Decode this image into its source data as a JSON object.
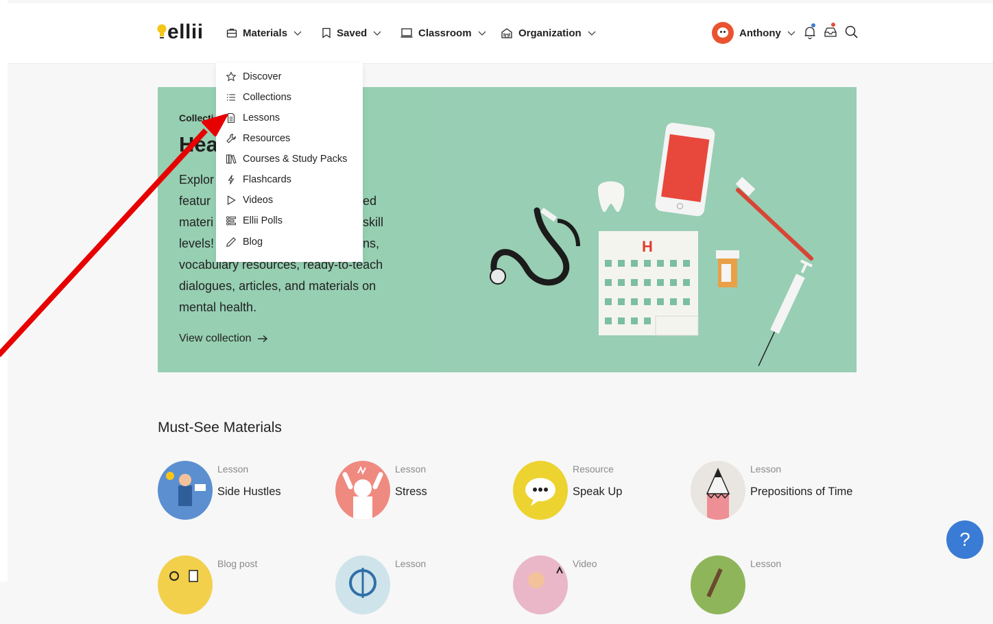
{
  "brand": {
    "logo_text": "ellii"
  },
  "nav": {
    "materials": "Materials",
    "saved": "Saved",
    "classroom": "Classroom",
    "organization": "Organization"
  },
  "user": {
    "name": "Anthony"
  },
  "dropdown": {
    "items": [
      {
        "label": "Discover",
        "icon": "star-icon"
      },
      {
        "label": "Collections",
        "icon": "list-icon"
      },
      {
        "label": "Lessons",
        "icon": "document-icon"
      },
      {
        "label": "Resources",
        "icon": "wrench-icon"
      },
      {
        "label": "Courses & Study Packs",
        "icon": "books-icon"
      },
      {
        "label": "Flashcards",
        "icon": "bolt-icon"
      },
      {
        "label": "Videos",
        "icon": "play-icon"
      },
      {
        "label": "Ellii Polls",
        "icon": "poll-icon"
      },
      {
        "label": "Blog",
        "icon": "pencil-icon"
      }
    ]
  },
  "hero": {
    "kicker": "Collecti",
    "title": "Hea",
    "desc_lines": [
      "Explor",
      "featur",
      "materi",
      "levels!"
    ],
    "desc_tail": [
      "ed",
      "skill",
      "ns,"
    ],
    "desc_rest": "vocabulary resources, ready-to-teach dialogues, articles, and materials on mental health.",
    "link": "View collection",
    "sign_letter": "H"
  },
  "section": {
    "title": "Must-See Materials"
  },
  "cards": [
    {
      "type": "Lesson",
      "title": "Side Hustles",
      "color": "#5b8fd0"
    },
    {
      "type": "Lesson",
      "title": "Stress",
      "color": "#ef8a80"
    },
    {
      "type": "Resource",
      "title": "Speak Up",
      "color": "#ecd330"
    },
    {
      "type": "Lesson",
      "title": "Prepositions of Time",
      "color": "#e9e5e0"
    },
    {
      "type": "Blog post",
      "title": "",
      "color": "#f2d04b"
    },
    {
      "type": "Lesson",
      "title": "",
      "color": "#cfe3ea"
    },
    {
      "type": "Video",
      "title": "",
      "color": "#e9b7c8"
    },
    {
      "type": "Lesson",
      "title": "",
      "color": "#8fb55a"
    }
  ],
  "help": {
    "label": "?"
  },
  "colors": {
    "hero_bg": "#96cfb1",
    "accent_blue": "#3a7bd5",
    "annotation_arrow": "#e60000"
  }
}
